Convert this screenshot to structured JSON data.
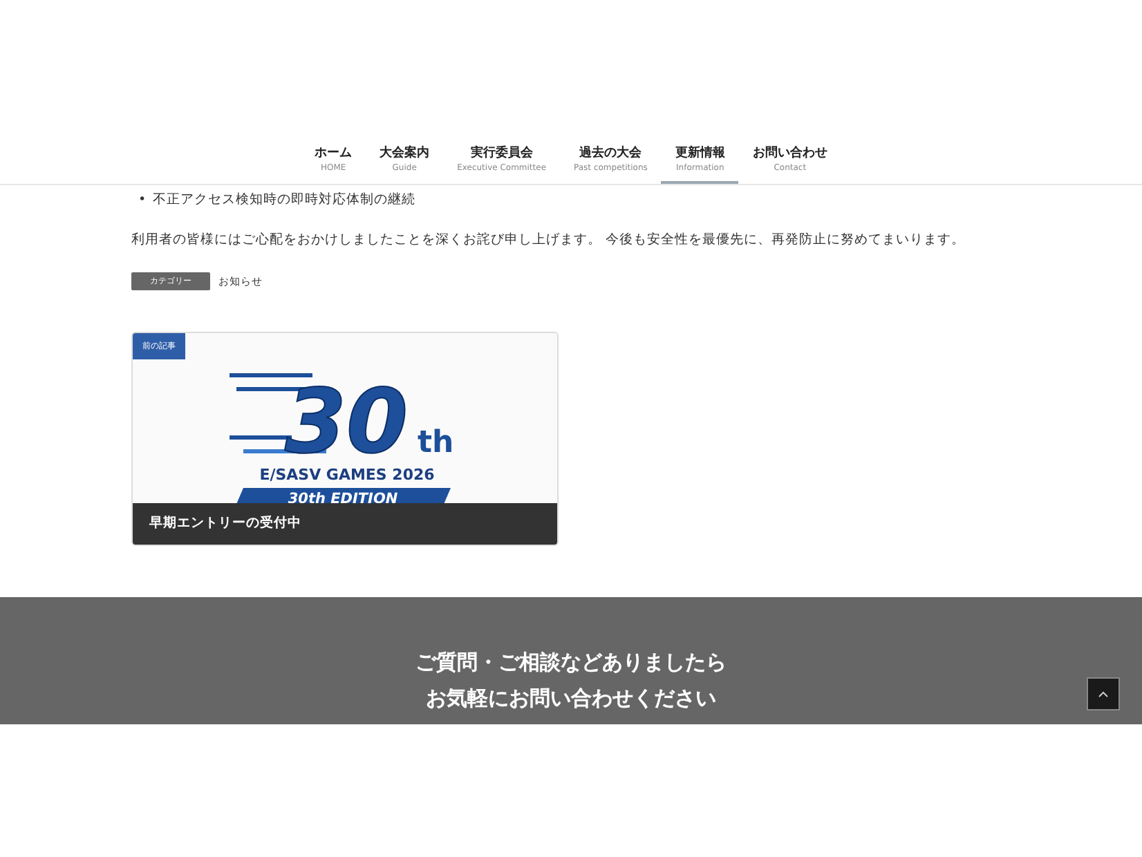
{
  "nav": [
    {
      "label": "ホーム",
      "sub": "HOME",
      "selected": false
    },
    {
      "label": "大会案内",
      "sub": "Guide",
      "selected": false
    },
    {
      "label": "実行委員会",
      "sub": "Executive Committee",
      "selected": false
    },
    {
      "label": "過去の大会",
      "sub": "Past competitions",
      "selected": false
    },
    {
      "label": "更新情報",
      "sub": "Information",
      "selected": true
    },
    {
      "label": "お問い合わせ",
      "sub": "Contact",
      "selected": false
    }
  ],
  "article": {
    "bullets": [
      {
        "marker": "•",
        "text": "不正アクセス検知時の即時対応体制の継続"
      }
    ],
    "paragraph": "利用者の皆様にはご心配をおかけしましたことを深くお詫び申し上げます。 今後も安全性を最優先に、再発防止に努めてまいります。",
    "category_label": "カテゴリー",
    "category": "お知らせ"
  },
  "prev_post": {
    "badge": "前の記事",
    "logo": {
      "number": "30",
      "suffix": "th",
      "games": "E/SASV GAMES 2026",
      "edition": "30th EDITION"
    },
    "title": "早期エントリーの受付中"
  },
  "footer_cta": {
    "lines": [
      "ご質問・ご相談などありましたら",
      "お気軽にお問い合わせください"
    ]
  }
}
